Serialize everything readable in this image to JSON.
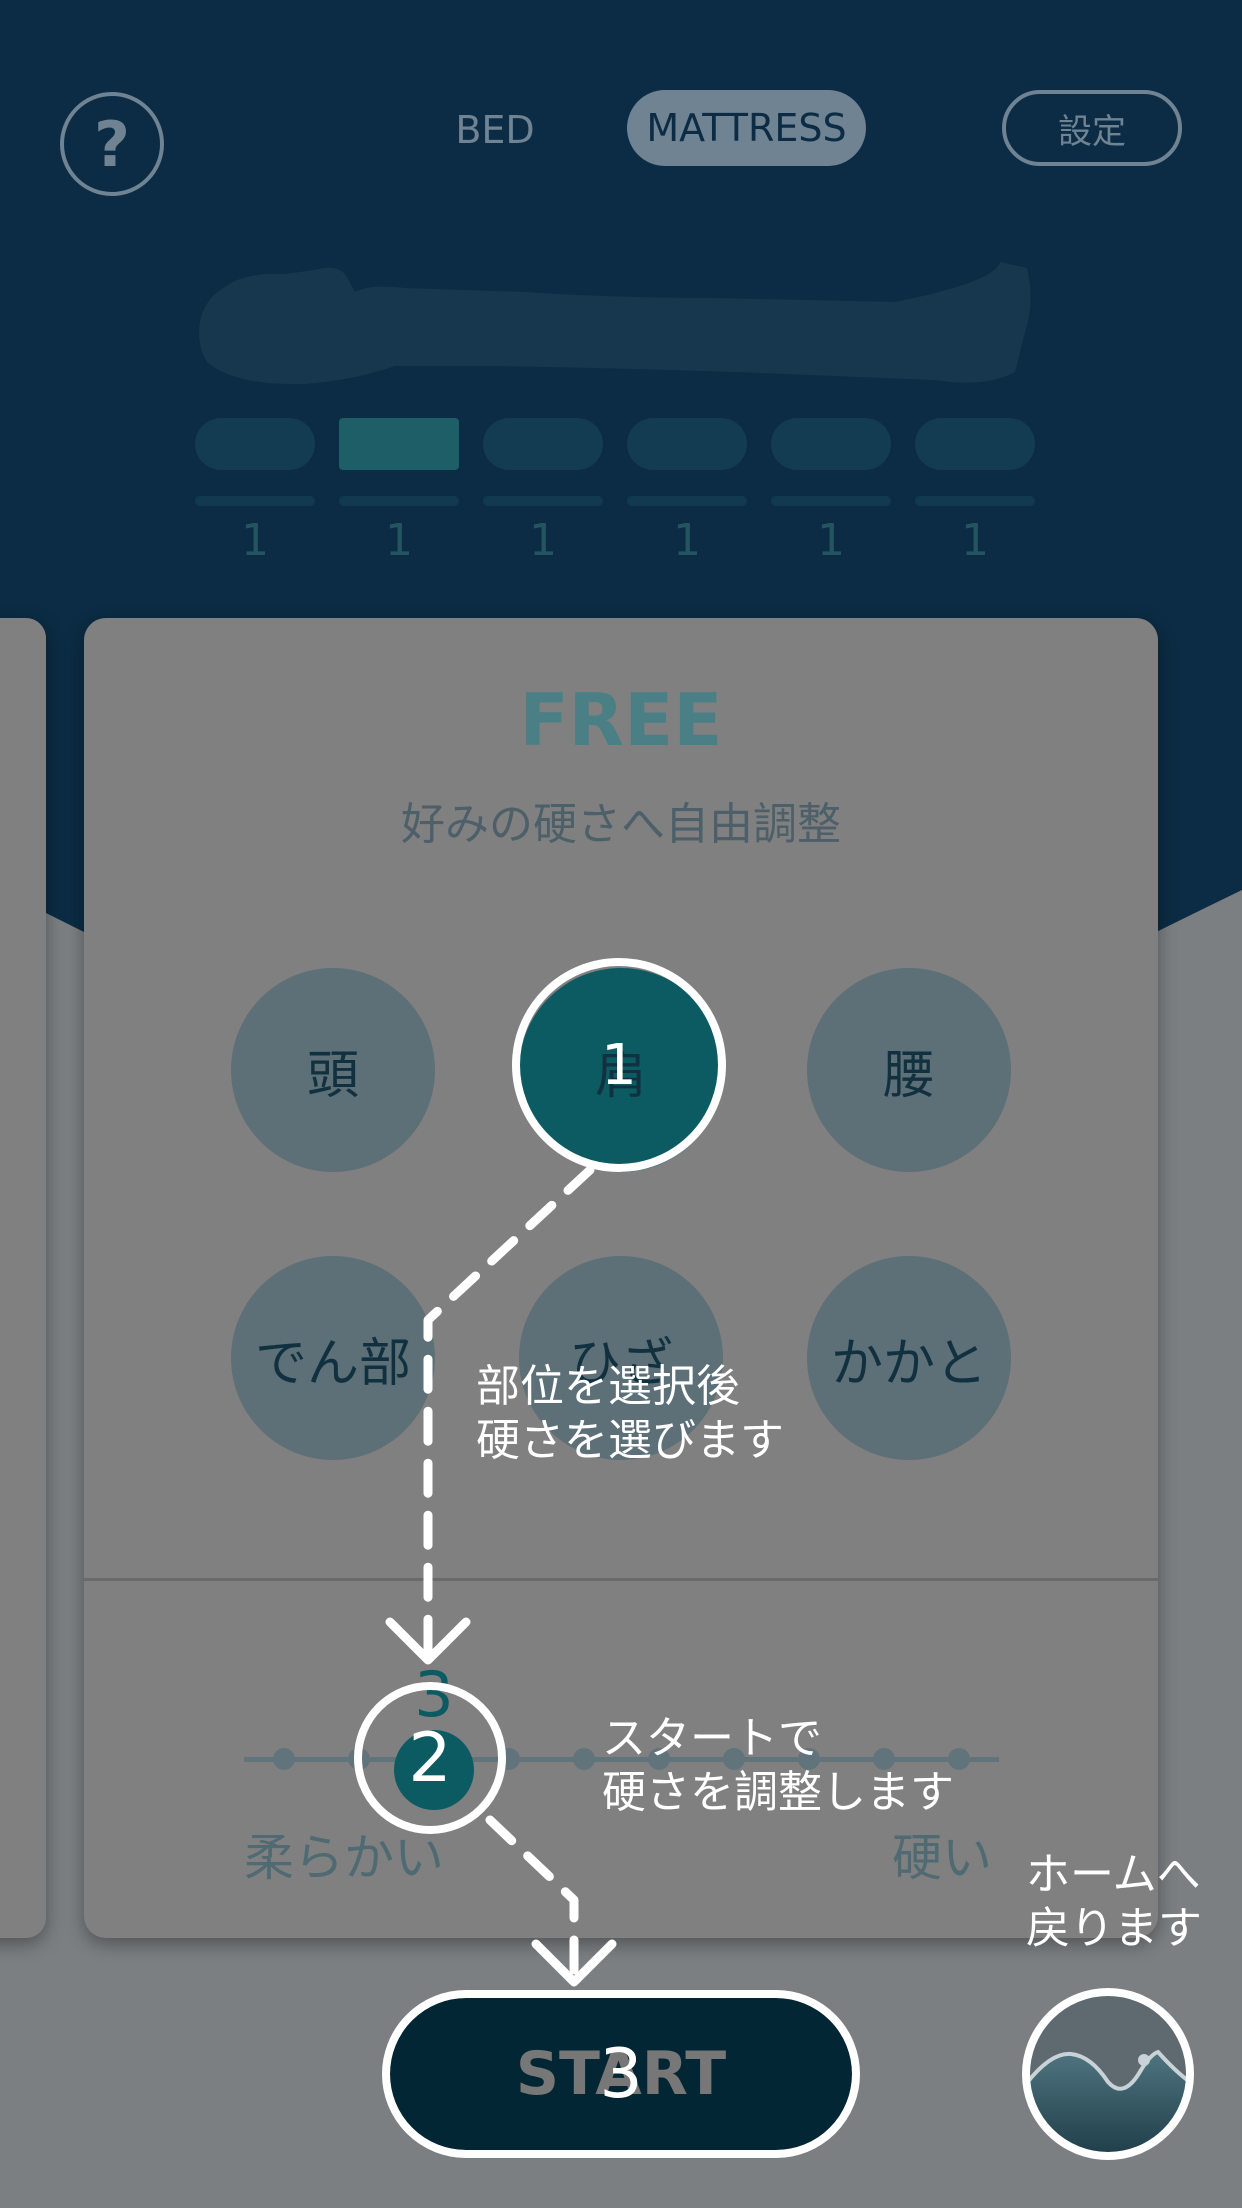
{
  "header": {
    "help_icon_text": "?",
    "tab_bed": "BED",
    "tab_mattress": "MATTRESS",
    "settings_label": "設定"
  },
  "segments": {
    "values": [
      "1",
      "1",
      "1",
      "1",
      "1",
      "1"
    ],
    "selected_index": 1
  },
  "card": {
    "title": "FREE",
    "subtitle": "好みの硬さへ自由調整",
    "parts": [
      "頭",
      "肩",
      "腰",
      "でん部",
      "ひざ",
      "かかと"
    ],
    "selected_part": "肩",
    "slider_value": "3",
    "soft_label": "柔らかい",
    "hard_label": "硬い"
  },
  "start_label": "START",
  "tutorial": {
    "step1": "1",
    "step2": "2",
    "step3": "3",
    "tip1": "部位を選択後\n硬さを選びます",
    "tip2": "スタートで\n硬さを調整します",
    "tip3": "ホームへ\n戻ります"
  },
  "colors": {
    "dark_navy": "#0b2c44",
    "teal_accent": "#0c5b63",
    "dim_overlay_gray": "#808080"
  }
}
